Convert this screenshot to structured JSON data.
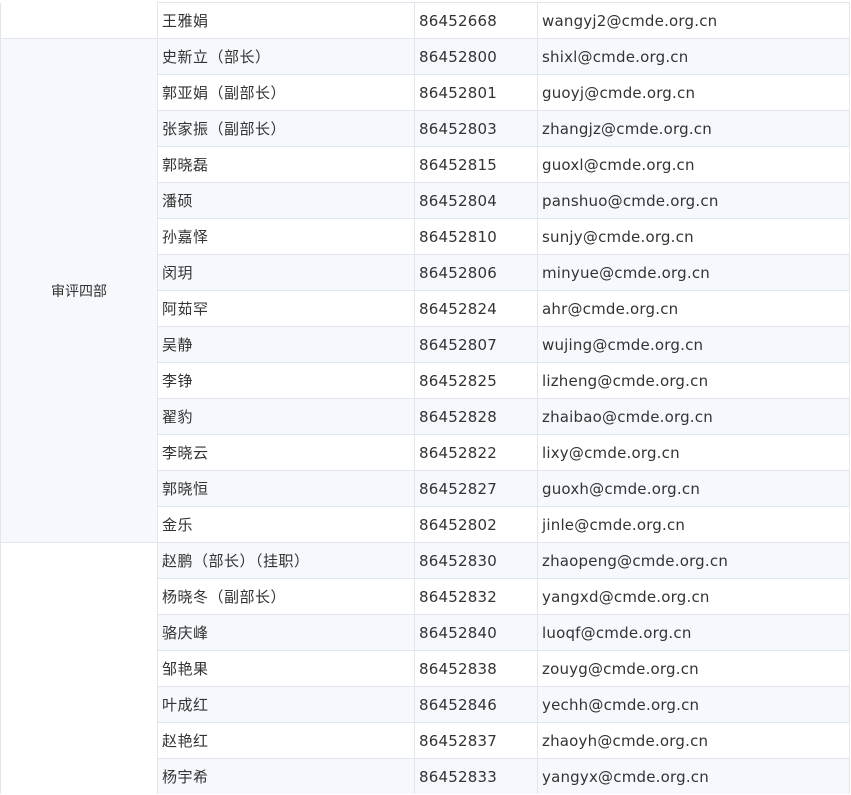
{
  "colors": {
    "stripe": "#f5f8fc",
    "border": "#e2e6ec",
    "text": "#333333"
  },
  "groups": [
    {
      "department": "",
      "rows": [
        {
          "name": "王雅娟",
          "phone": "86452668",
          "email": "wangyj2@cmde.org.cn"
        }
      ]
    },
    {
      "department": "审评四部",
      "rows": [
        {
          "name": "史新立（部长）",
          "phone": "86452800",
          "email": "shixl@cmde.org.cn"
        },
        {
          "name": "郭亚娟（副部长）",
          "phone": "86452801",
          "email": "guoyj@cmde.org.cn"
        },
        {
          "name": "张家振（副部长）",
          "phone": "86452803",
          "email": "zhangjz@cmde.org.cn"
        },
        {
          "name": "郭晓磊",
          "phone": "86452815",
          "email": "guoxl@cmde.org.cn"
        },
        {
          "name": "潘硕",
          "phone": "86452804",
          "email": "panshuo@cmde.org.cn"
        },
        {
          "name": "孙嘉怿",
          "phone": "86452810",
          "email": "sunjy@cmde.org.cn"
        },
        {
          "name": "闵玥",
          "phone": "86452806",
          "email": "minyue@cmde.org.cn"
        },
        {
          "name": "阿茹罕",
          "phone": "86452824",
          "email": "ahr@cmde.org.cn"
        },
        {
          "name": "吴静",
          "phone": "86452807",
          "email": "wujing@cmde.org.cn"
        },
        {
          "name": "李铮",
          "phone": "86452825",
          "email": "lizheng@cmde.org.cn"
        },
        {
          "name": "翟豹",
          "phone": "86452828",
          "email": "zhaibao@cmde.org.cn"
        },
        {
          "name": "李晓云",
          "phone": "86452822",
          "email": "lixy@cmde.org.cn"
        },
        {
          "name": "郭晓恒",
          "phone": "86452827",
          "email": "guoxh@cmde.org.cn"
        },
        {
          "name": "金乐",
          "phone": "86452802",
          "email": "jinle@cmde.org.cn"
        }
      ]
    },
    {
      "department": "",
      "rows": [
        {
          "name": "赵鹏（部长）（挂职）",
          "phone": "86452830",
          "email": "zhaopeng@cmde.org.cn"
        },
        {
          "name": "杨晓冬（副部长）",
          "phone": "86452832",
          "email": "yangxd@cmde.org.cn"
        },
        {
          "name": "骆庆峰",
          "phone": "86452840",
          "email": "luoqf@cmde.org.cn"
        },
        {
          "name": "邹艳果",
          "phone": "86452838",
          "email": "zouyg@cmde.org.cn"
        },
        {
          "name": "叶成红",
          "phone": "86452846",
          "email": "yechh@cmde.org.cn"
        },
        {
          "name": "赵艳红",
          "phone": "86452837",
          "email": "zhaoyh@cmde.org.cn"
        },
        {
          "name": "杨宇希",
          "phone": "86452833",
          "email": "yangyx@cmde.org.cn"
        }
      ]
    }
  ]
}
